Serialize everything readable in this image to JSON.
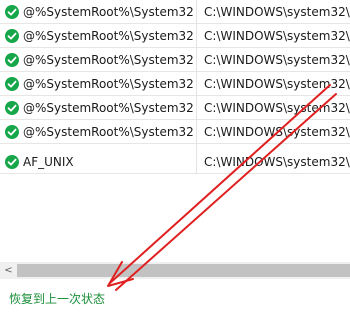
{
  "colors": {
    "check": "#17a74a",
    "link": "#1c8f3a",
    "annotation_arrow": "#e02020",
    "scrollbar_track": "#f0f0f0",
    "scrollbar_thumb": "#c2c2c2"
  },
  "rows": [
    {
      "name": "@%SystemRoot%\\System32...",
      "path": "C:\\WINDOWS\\system32\\m",
      "icon": "check-circle-icon"
    },
    {
      "name": "@%SystemRoot%\\System32...",
      "path": "C:\\WINDOWS\\system32\\m",
      "icon": "check-circle-icon"
    },
    {
      "name": "@%SystemRoot%\\System32...",
      "path": "C:\\WINDOWS\\system32\\m",
      "icon": "check-circle-icon"
    },
    {
      "name": "@%SystemRoot%\\System32...",
      "path": "C:\\WINDOWS\\system32\\m",
      "icon": "check-circle-icon"
    },
    {
      "name": "@%SystemRoot%\\System32...",
      "path": "C:\\WINDOWS\\system32\\m",
      "icon": "check-circle-icon"
    },
    {
      "name": "@%SystemRoot%\\System32...",
      "path": "C:\\WINDOWS\\system32\\m",
      "icon": "check-circle-icon"
    },
    {
      "name": "AF_UNIX",
      "path": "C:\\WINDOWS\\system32\\m",
      "icon": "check-circle-icon"
    }
  ],
  "scrollbar": {
    "left_arrow": "<"
  },
  "footer": {
    "restore_label": "恢复到上一次状态"
  }
}
